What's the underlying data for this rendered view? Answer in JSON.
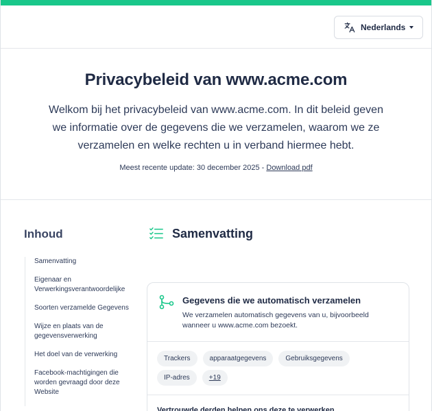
{
  "header": {
    "language_label": "Nederlands"
  },
  "hero": {
    "title": "Privacybeleid van www.acme.com",
    "intro": "Welkom bij het privacybeleid van www.acme.com. In dit beleid geven we informatie over de gegevens die we verzamelen, waarom we ze verzamelen en welke rechten u in verband hiermee hebt.",
    "update_text": "Meest recente update: 30 december 2025 - ",
    "download_label": "Download pdf"
  },
  "toc": {
    "title": "Inhoud",
    "items": [
      "Samenvatting",
      "Eigenaar en Verwerkingsverantwoordelijke",
      "Soorten verzamelde Gegevens",
      "Wijze en plaats van de gegevensverwerking",
      "Het doel van de verwerking",
      "Facebook-machtigingen die worden gevraagd door deze Website"
    ]
  },
  "summary": {
    "title": "Samenvatting"
  },
  "card": {
    "title": "Gegevens die we automatisch verzamelen",
    "description": "We verzamelen automatisch gegevens van u, bijvoorbeeld wanneer u www.acme.com bezoekt.",
    "tags": [
      "Trackers",
      "apparaatgegevens",
      "Gebruiksgegevens",
      "IP-adres"
    ],
    "more_label": "+19",
    "footer_text": "Vertrouwde derden helpen ons deze te verwerken"
  },
  "colors": {
    "accent": "#19c78a",
    "text": "#1f2a44"
  },
  "icons": {
    "language": "translate-icon",
    "summary": "checklist-icon",
    "card": "share-nodes-icon"
  }
}
